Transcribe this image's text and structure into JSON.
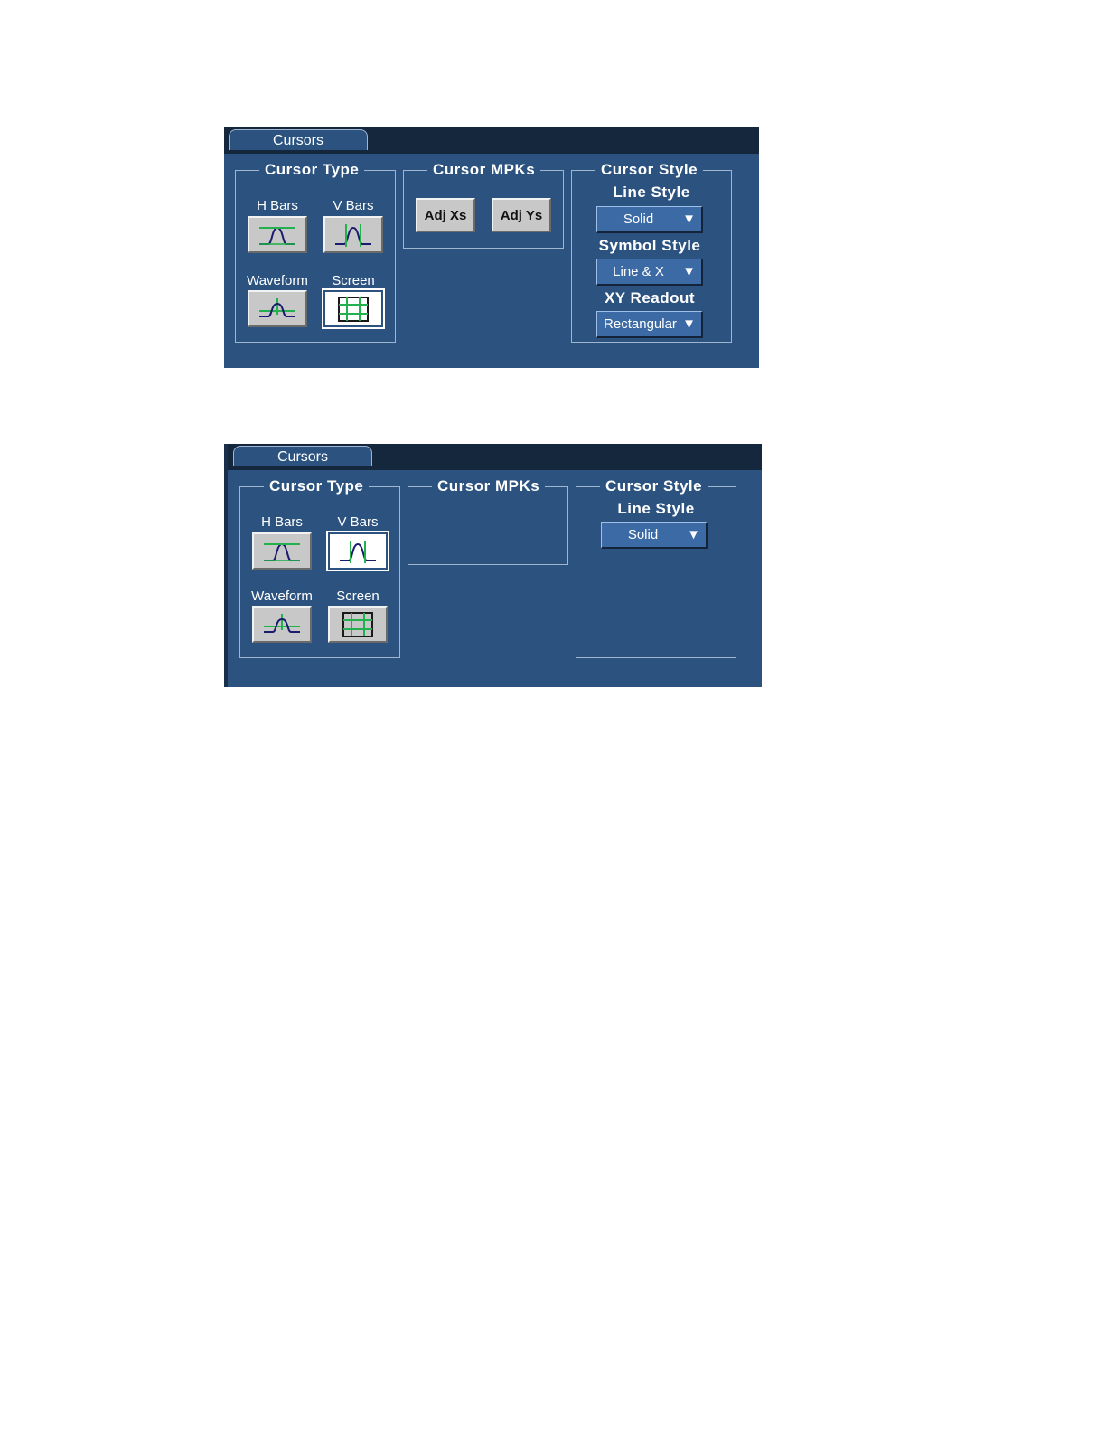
{
  "panel1": {
    "tab_label": "Cursors",
    "cursor_type": {
      "title": "Cursor Type",
      "hbars_label": "H Bars",
      "vbars_label": "V Bars",
      "waveform_label": "Waveform",
      "screen_label": "Screen",
      "selected": "Screen"
    },
    "cursor_mpks": {
      "title": "Cursor MPKs",
      "adj_xs_label": "Adj Xs",
      "adj_ys_label": "Adj Ys"
    },
    "cursor_style": {
      "title": "Cursor Style",
      "line_style_label": "Line Style",
      "line_style_value": "Solid",
      "symbol_style_label": "Symbol Style",
      "symbol_style_value": "Line & X",
      "xy_readout_label": "XY Readout",
      "xy_readout_value": "Rectangular"
    }
  },
  "panel2": {
    "tab_label": "Cursors",
    "cursor_type": {
      "title": "Cursor Type",
      "hbars_label": "H Bars",
      "vbars_label": "V Bars",
      "waveform_label": "Waveform",
      "screen_label": "Screen",
      "selected": "V Bars"
    },
    "cursor_mpks": {
      "title": "Cursor MPKs"
    },
    "cursor_style": {
      "title": "Cursor Style",
      "line_style_label": "Line Style",
      "line_style_value": "Solid"
    }
  },
  "icons": {
    "dropdown_arrow": "▼",
    "hbars": "hbars-icon",
    "vbars": "vbars-icon",
    "waveform": "waveform-icon",
    "screen": "screen-cursor-icon"
  },
  "colors": {
    "panel_bg": "#2c5380",
    "tabbar_bg": "#15273d",
    "dropdown_bg": "#3c6aa5",
    "cursor_green": "#22b14c",
    "trace_navy": "#1a1a6e"
  }
}
